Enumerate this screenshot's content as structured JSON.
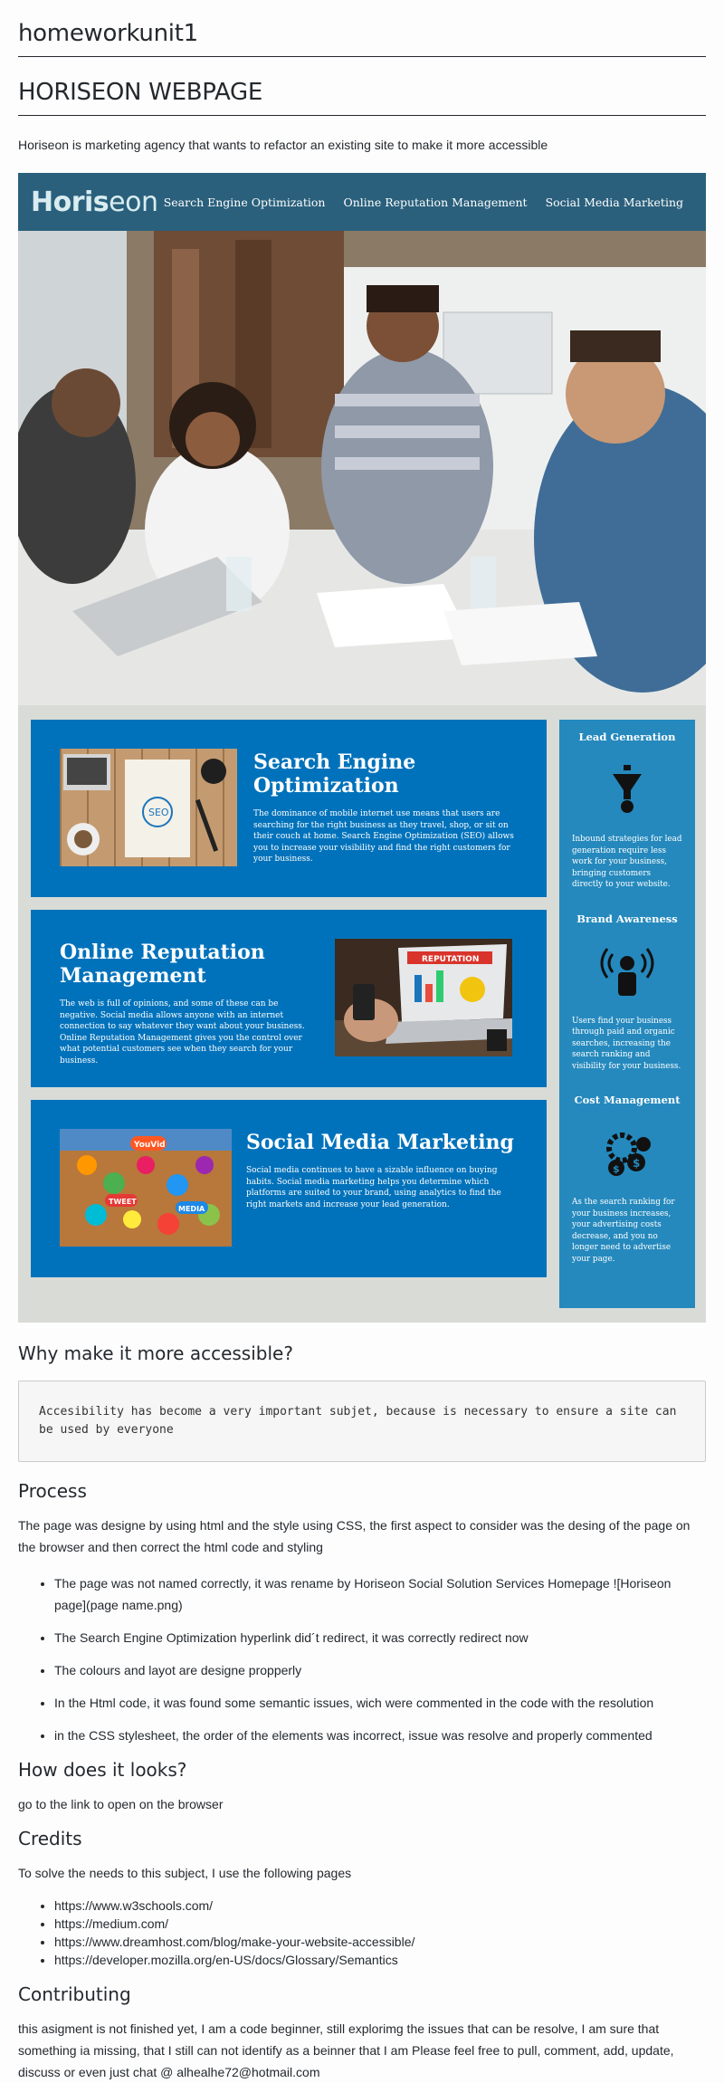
{
  "doc": {
    "title": "homeworkunit1",
    "subtitle": "HORISEON WEBPAGE",
    "intro": "Horiseon is marketing agency that wants to refactor an existing site to make it more accessible"
  },
  "mockup": {
    "logo_bold": "Horis",
    "logo_rest": "eon",
    "nav": [
      "Search Engine Optimization",
      "Online Reputation Management",
      "Social Media Marketing"
    ],
    "cards": [
      {
        "title": "Search Engine Optimization",
        "text": "The dominance of mobile internet use means that users are searching for the right business as they travel, shop, or sit on their couch at home. Search Engine Optimization (SEO) allows you to increase your visibility and find the right customers for your business."
      },
      {
        "title": "Online Reputation Management",
        "text": "The web is full of opinions, and some of these can be negative. Social media allows anyone with an internet connection to say whatever they want about your business. Online Reputation Management gives you the control over what potential customers see when they search for your business."
      },
      {
        "title": "Social Media Marketing",
        "text": "Social media continues to have a sizable influence on buying habits. Social media marketing helps you determine which platforms are suited to your brand, using analytics to find the right markets and increase your lead generation."
      }
    ],
    "benefits": [
      {
        "title": "Lead Generation",
        "text": "Inbound strategies for lead generation require less work for your business, bringing customers directly to your website."
      },
      {
        "title": "Brand Awareness",
        "text": "Users find your business through paid and organic searches, increasing the search ranking and visibility for your business."
      },
      {
        "title": "Cost Management",
        "text": "As the search ranking for your business increases, your advertising costs decrease, and you no longer need to advertise your page."
      }
    ],
    "seo_labels": [
      "SEO"
    ],
    "rep_label": "REPUTATION",
    "sm_labels": [
      "YouVid",
      "TWEET",
      "MEDIA"
    ]
  },
  "why": {
    "heading": "Why make it more accessible?",
    "code": "Accesibility has become a very important subjet, because is necessary to ensure a site can be used by everyone"
  },
  "process": {
    "heading": "Process",
    "text": "The page was designe by using html and the style using CSS, the first aspect to consider was the desing of the page on the browser and then correct the html code and styling",
    "items": [
      "The page was not named correctly, it was rename by Horiseon Social Solution Services Homepage ![Horiseon page](page name.png)",
      "The Search Engine Optimization hyperlink did´t redirect, it was correctly redirect now",
      "The colours and layot are designe propperly",
      "In the Html code, it was found some semantic issues, wich were commented in the code with the resolution",
      "in the CSS stylesheet, the order of the elements was incorrect, issue was resolve and properly commented"
    ]
  },
  "looks": {
    "heading": "How does it looks?",
    "text": "go to the link to open on the browser"
  },
  "credits": {
    "heading": "Credits",
    "text": "To solve the needs to this subject, I use the following pages",
    "links": [
      "https://www.w3schools.com/",
      "https://medium.com/",
      "https://www.dreamhost.com/blog/make-your-website-accessible/",
      "https://developer.mozilla.org/en-US/docs/Glossary/Semantics"
    ]
  },
  "contributing": {
    "heading": "Contributing",
    "text": "this asigment is not finished yet, I am a code beginner, still explorimg the issues that can be resolve, I am sure that something ia missing, that I still can not identify as a beinner that I am Please feel free to pull, comment, add, update, discuss or even just chat @ alhealhe72@hotmail.com"
  },
  "colors": {
    "header": "#2a607c",
    "card": "#0072bb",
    "sidebar": "#2589bd",
    "mock_bg": "#d9dcd6"
  }
}
